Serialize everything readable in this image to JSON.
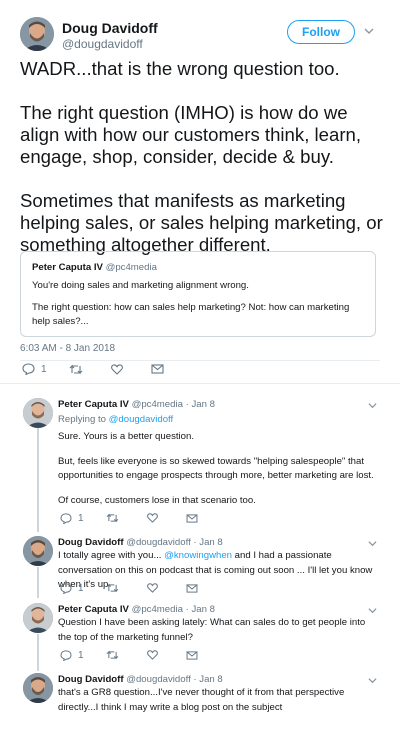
{
  "main_tweet": {
    "author_name": "Doug Davidoff",
    "author_handle": "@dougdavidoff",
    "follow_label": "Follow",
    "paragraphs": [
      "WADR...that is the wrong question too.",
      "The right question (IMHO) is how do we align with how our customers think, learn, engage, shop, consider, decide & buy.",
      "Sometimes that manifests as marketing helping sales, or sales helping marketing, or something altogether different."
    ],
    "quote": {
      "author_name": "Peter Caputa IV",
      "author_handle": "@pc4media",
      "line1": "You're doing sales and marketing alignment wrong.",
      "line2": "The right question: how can sales help marketing? Not: how can marketing help sales?..."
    },
    "timestamp": "6:03 AM - 8 Jan 2018",
    "reply_count": "1"
  },
  "replies": [
    {
      "author_name": "Peter Caputa IV",
      "author_handle": "@pc4media",
      "date": "· Jan 8",
      "replying_prefix": "Replying to ",
      "replying_handle": "@dougdavidoff",
      "paragraphs": [
        "Sure. Yours is a better question.",
        "But, feels like everyone is so skewed towards \"helping salespeople\" that opportunities to engage prospects through more, better marketing are lost.",
        "Of course, customers lose in that scenario too."
      ],
      "reply_count": "1"
    },
    {
      "author_name": "Doug Davidoff",
      "author_handle": "@dougdavidoff",
      "date": "· Jan 8",
      "text_before": "I totally agree with you... ",
      "mention": "@knowingwhen",
      "text_after": " and I had a passionate conversation on this on podcast that is coming out soon ... I'll let you know when it's up",
      "reply_count": "1"
    },
    {
      "author_name": "Peter Caputa IV",
      "author_handle": "@pc4media",
      "date": "· Jan 8",
      "text": "Question I have been asking lately: What can sales do to get people into the top of the marketing funnel?",
      "reply_count": "1"
    },
    {
      "author_name": "Doug Davidoff",
      "author_handle": "@dougdavidoff",
      "date": "· Jan 8",
      "text": "that's a GR8 question...I've never thought of it from that perspective directly...I think I may write a blog post on the subject"
    }
  ],
  "colors": {
    "accent": "#1da1f2",
    "secondary_text": "#657786",
    "border": "#ccd6dd"
  },
  "icons": [
    "chevron-down-icon",
    "reply-icon",
    "retweet-icon",
    "like-icon",
    "message-icon"
  ]
}
